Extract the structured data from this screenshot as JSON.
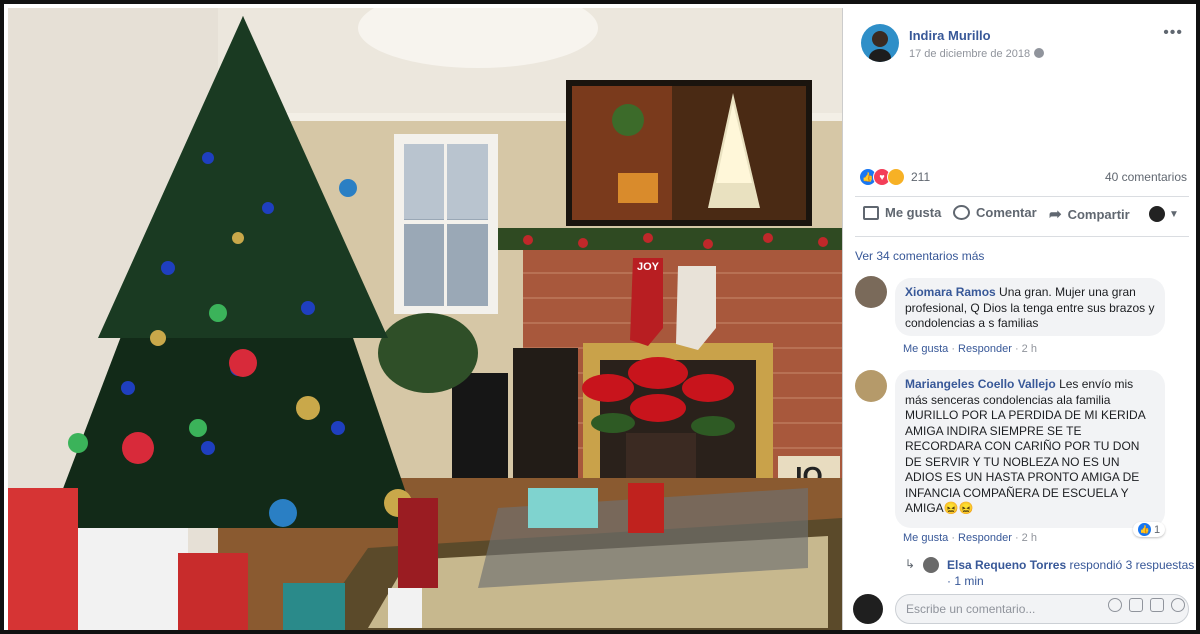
{
  "post": {
    "author": "Indira Murillo",
    "date": "17 de diciembre de 2018",
    "reaction_count": "211",
    "comment_count": "40 comentarios",
    "actions": {
      "like": "Me gusta",
      "comment": "Comentar",
      "share": "Compartir"
    },
    "more_comments": "Ver 34 comentarios más"
  },
  "photo": {
    "stocking_text": "JOY",
    "sign_text": "IO"
  },
  "comments": [
    {
      "author": "Xiomara Ramos",
      "text": "Una gran. Mujer una gran profesional, Q Dios la tenga entre sus brazos y condolencias a s familias",
      "like": "Me gusta",
      "reply": "Responder",
      "time": "2 h"
    },
    {
      "author": "Mariangeles Coello Vallejo",
      "text": "Les envío mis más senceras condolencias ala familia MURILLO POR LA PERDIDA DE MI KERIDA AMIGA INDIRA SIEMPRE SE TE RECORDARA CON CARIÑO POR TU DON DE SERVIR Y TU NOBLEZA NO ES UN ADIOS ES UN HASTA PRONTO AMIGA DE INFANCIA COMPAÑERA DE ESCUELA Y AMIGA😖😖",
      "like": "Me gusta",
      "reply": "Responder",
      "time": "2 h",
      "like_count": "1"
    }
  ],
  "reply_summary": {
    "author": "Elsa Requeno Torres",
    "text": "respondió",
    "count": "3",
    "more": "respuestas · 1 min"
  },
  "composer": {
    "placeholder": "Escribe un comentario..."
  },
  "colors": {
    "link": "#385898",
    "muted": "#90949c",
    "like_blue": "#1877f2",
    "love_red": "#f33e58",
    "haha_yellow": "#f7b125"
  }
}
